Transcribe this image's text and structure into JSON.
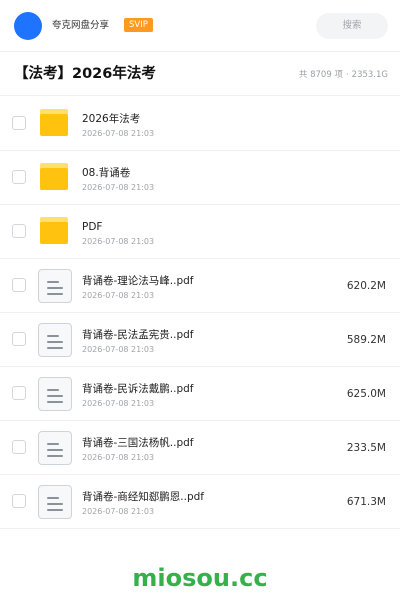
{
  "header": {
    "user_name": "夸克网盘分享",
    "badge": "SVIP",
    "search_label": "搜索"
  },
  "folder": {
    "title": "【法考】2026年法考",
    "summary_count": "共 8709 项",
    "summary_size": "2353.1G"
  },
  "items": [
    {
      "type": "folder",
      "icon": "folder-icon",
      "name": "2026年法考",
      "date": "2026-07-08 21:03",
      "size": ""
    },
    {
      "type": "folder",
      "icon": "folder-icon",
      "name": "08.背诵卷",
      "date": "2026-07-08 21:03",
      "size": ""
    },
    {
      "type": "folder",
      "icon": "folder-icon",
      "name": "PDF",
      "date": "2026-07-08 21:03",
      "size": ""
    },
    {
      "type": "file",
      "icon": "document-icon",
      "name": "背诵卷-理论法马峰..pdf",
      "date": "2026-07-08 21:03",
      "size": "620.2M"
    },
    {
      "type": "file",
      "icon": "document-icon",
      "name": "背诵卷-民法孟宪贵..pdf",
      "date": "2026-07-08 21:03",
      "size": "589.2M"
    },
    {
      "type": "file",
      "icon": "document-icon",
      "name": "背诵卷-民诉法戴鹏..pdf",
      "date": "2026-07-08 21:03",
      "size": "625.0M"
    },
    {
      "type": "file",
      "icon": "document-icon",
      "name": "背诵卷-三国法杨帆..pdf",
      "date": "2026-07-08 21:03",
      "size": "233.5M"
    },
    {
      "type": "file",
      "icon": "document-icon",
      "name": "背诵卷-商经知郄鹏恩..pdf",
      "date": "2026-07-08 21:03",
      "size": "671.3M"
    }
  ],
  "watermark": "miosou.cc",
  "colors": {
    "avatar": "#1f74ff",
    "badge": "#ff9a1f",
    "folder": "#ffc20f",
    "watermark": "#35b04b"
  }
}
